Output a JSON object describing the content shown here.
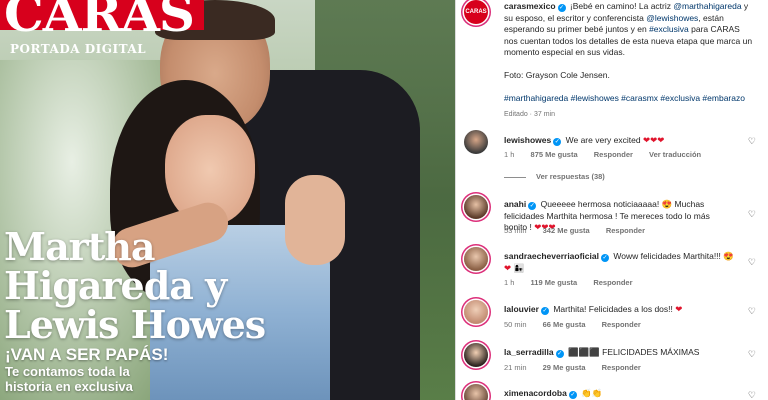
{
  "cover": {
    "logo": "CARAS",
    "portada": "PORTADA DIGITAL",
    "headline_lines": [
      "Martha",
      "Higareda y",
      "Lewis Howes"
    ],
    "subtitle": "¡VAN A SER PAPÁS!",
    "tagline": "Te contamos toda la historia en exclusiva"
  },
  "post": {
    "avatar_label": "CARAS",
    "username": "carasmexico",
    "caption_intro": "¡Bebé en camino! La actriz",
    "mention1": "@marthahigareda",
    "caption_mid1": "y su esposo, el escritor y conferencista",
    "mention2": "@lewishowes",
    "caption_mid2": ", están esperando su primer bebé juntos y en",
    "hashtag_excl": "#exclusiva",
    "caption_end": "para CARAS nos cuentan todos los detalles de esta nueva etapa que marca un momento especial en sus vidas.",
    "photo_credit": "Foto: Grayson Cole Jensen.",
    "hashtags": "#marthahigareda #lewishowes #carasmx #exclusiva #embarazo",
    "edited": "Editado · 37 min"
  },
  "comments": [
    {
      "username": "lewishowes",
      "text": "We are very excited",
      "emoji": "❤❤❤",
      "time": "1 h",
      "likes": "875 Me gusta",
      "reply": "Responder",
      "translate": "Ver traducción",
      "view_replies": "Ver respuestas (38)"
    },
    {
      "username": "anahi",
      "text1": "Queeeee hermosa noticiaaaaa!",
      "emoji1": "😍",
      "text2": "Muchas felicidades Marthita hermosa ! Te mereces todo lo más bonito !",
      "emoji2": "❤❤❤",
      "time": "53 min",
      "likes": "342 Me gusta",
      "reply": "Responder"
    },
    {
      "username": "sandraecheverriaoficial",
      "text": "Woww felicidades Marthita!!!",
      "emoji": "😍❤",
      "emoji2": "👩‍👧",
      "time": "1 h",
      "likes": "119 Me gusta",
      "reply": "Responder"
    },
    {
      "username": "lalouvier",
      "text": "Marthita! Felicidades a los dos!!",
      "emoji": "❤",
      "time": "50 min",
      "likes": "66 Me gusta",
      "reply": "Responder"
    },
    {
      "username": "la_serradilla",
      "text": "⬛⬛⬛ FELICIDADES MÁXIMAS",
      "time": "21 min",
      "likes": "29 Me gusta",
      "reply": "Responder"
    },
    {
      "username": "ximenacordoba",
      "emoji": "👏👏"
    }
  ],
  "icons": {
    "like": "heart-outline-icon",
    "verified": "verified-badge-icon"
  },
  "colors": {
    "brand": "#d7001c",
    "link": "#00376b",
    "meta": "#737373",
    "verified": "#0095f6"
  }
}
